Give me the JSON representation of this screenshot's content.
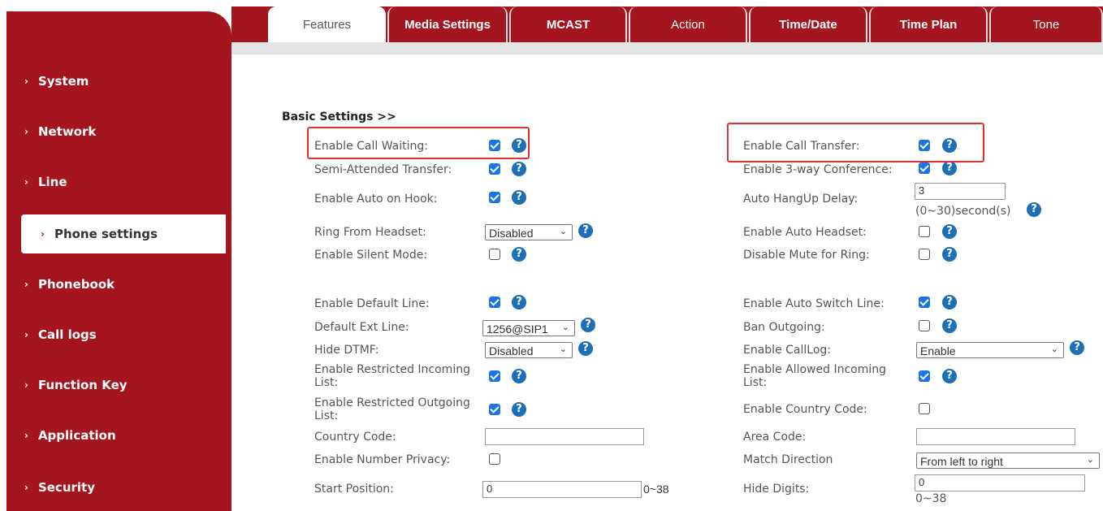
{
  "sidebar": {
    "items": [
      {
        "label": "System"
      },
      {
        "label": "Network"
      },
      {
        "label": "Line"
      },
      {
        "label": "Phone settings"
      },
      {
        "label": "Phonebook"
      },
      {
        "label": "Call logs"
      },
      {
        "label": "Function Key"
      },
      {
        "label": "Application"
      },
      {
        "label": "Security"
      }
    ]
  },
  "tabs": [
    "Features",
    "Media Settings",
    "MCAST",
    "Action",
    "Time/Date",
    "Time Plan",
    "Tone"
  ],
  "section_title": "Basic Settings >>",
  "help_glyph": "?",
  "form": {
    "enable_call_waiting": "Enable Call Waiting:",
    "semi_attended_transfer": "Semi-Attended Transfer:",
    "enable_auto_on_hook": "Enable Auto on Hook:",
    "ring_from_headset": "Ring From Headset:",
    "ring_from_headset_value": "Disabled",
    "enable_silent_mode": "Enable Silent Mode:",
    "enable_default_line": "Enable Default Line:",
    "default_ext_line": "Default Ext Line:",
    "default_ext_line_value": "1256@SIP1",
    "hide_dtmf": "Hide DTMF:",
    "hide_dtmf_value": "Disabled",
    "enable_restricted_incoming_1": "Enable Restricted Incoming",
    "enable_restricted_incoming_2": "List:",
    "enable_restricted_outgoing_1": "Enable Restricted Outgoing",
    "enable_restricted_outgoing_2": "List:",
    "country_code": "Country Code:",
    "country_code_value": "",
    "enable_number_privacy": "Enable Number Privacy:",
    "start_position": "Start Position:",
    "start_position_value": "0",
    "start_position_range": "0~38",
    "enable_call_transfer": "Enable Call Transfer:",
    "enable_3way": "Enable 3-way Conference:",
    "auto_hangup_delay": "Auto HangUp Delay:",
    "auto_hangup_delay_value": "3",
    "auto_hangup_delay_range": "(0~30)second(s)",
    "enable_auto_headset": "Enable Auto Headset:",
    "disable_mute_for_ring": "Disable Mute for Ring:",
    "enable_auto_switch_line": "Enable Auto Switch Line:",
    "ban_outgoing": "Ban Outgoing:",
    "enable_calllog": "Enable CallLog:",
    "enable_calllog_value": "Enable",
    "enable_allowed_incoming_1": "Enable Allowed Incoming",
    "enable_allowed_incoming_2": "List:",
    "enable_country_code": "Enable Country Code:",
    "area_code": "Area Code:",
    "area_code_value": "",
    "match_direction": "Match Direction",
    "match_direction_value": "From left to right",
    "hide_digits": "Hide Digits:",
    "hide_digits_value": "0",
    "hide_digits_range": "0~38"
  },
  "colors": {
    "brand": "#a5151f",
    "checkbox": "#1a73e8",
    "help": "#1e6fb5",
    "highlight": "#e53030"
  }
}
